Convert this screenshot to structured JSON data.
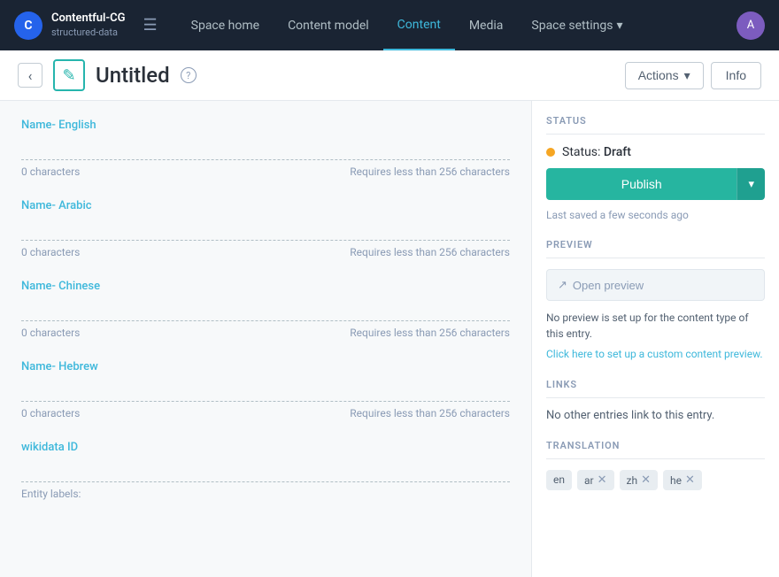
{
  "brand": {
    "name": "Contentful-CG",
    "sub": "structured-data",
    "logo": "C"
  },
  "nav": {
    "links": [
      {
        "label": "Space home",
        "active": false
      },
      {
        "label": "Content model",
        "active": false
      },
      {
        "label": "Content",
        "active": true
      },
      {
        "label": "Media",
        "active": false
      },
      {
        "label": "Space settings",
        "active": false,
        "hasArrow": true
      }
    ]
  },
  "header": {
    "back_label": "‹",
    "entry_title": "Untitled",
    "help_icon": "?",
    "actions_label": "Actions",
    "actions_arrow": "▾",
    "info_label": "Info"
  },
  "fields": [
    {
      "label": "Name- English",
      "chars": "0 characters",
      "limit": "Requires less than 256 characters"
    },
    {
      "label": "Name- Arabic",
      "chars": "0 characters",
      "limit": "Requires less than 256 characters"
    },
    {
      "label": "Name- Chinese",
      "chars": "0 characters",
      "limit": "Requires less than 256 characters"
    },
    {
      "label": "Name- Hebrew",
      "chars": "0 characters",
      "limit": "Requires less than 256 characters"
    }
  ],
  "wikidata": {
    "label": "wikidata ID",
    "entity_labels": "Entity labels:"
  },
  "sidebar": {
    "status_section_title": "STATUS",
    "status_label": "Status:",
    "status_value": "Draft",
    "publish_label": "Publish",
    "last_saved": "Last saved a few seconds ago",
    "preview_section_title": "PREVIEW",
    "open_preview_label": "Open preview",
    "preview_note": "No preview is set up for the content type of this entry.",
    "preview_link": "Click here to set up a custom content preview.",
    "links_section_title": "LINKS",
    "links_note": "No other entries link to this entry.",
    "translation_section_title": "TRANSLATION",
    "translation_chips": [
      {
        "label": "en",
        "removable": false
      },
      {
        "label": "ar",
        "removable": true
      },
      {
        "label": "zh",
        "removable": true
      },
      {
        "label": "he",
        "removable": true
      }
    ]
  }
}
